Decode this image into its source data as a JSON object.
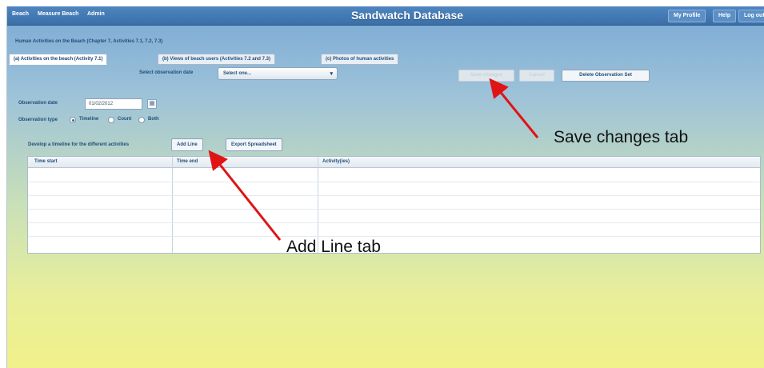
{
  "topbar": {
    "nav": [
      "Beach",
      "Measure Beach",
      "Admin"
    ],
    "title": "Sandwatch Database",
    "right_buttons": [
      "My Profile",
      "Help",
      "Log out"
    ]
  },
  "section_heading": "Human Activities on the Beach (Chapter 7, Activities 7.1, 7.2, 7.3)",
  "tabs": [
    {
      "label": "(a) Activities on the beach (Activity 7.1)",
      "active": true
    },
    {
      "label": "(b) Views of beach users (Activities 7.2 and 7.3)",
      "active": false
    },
    {
      "label": "(c) Photos of human activities",
      "active": false
    }
  ],
  "observation_select": {
    "label": "Select observation date",
    "value": "Select one..."
  },
  "actions": {
    "save_changes": "Save changes",
    "cancel": "Cancel",
    "delete_set": "Delete Observation Set"
  },
  "form": {
    "date_label": "Observation date",
    "date_value": "01/02/2012",
    "type_label": "Observation type",
    "types": [
      {
        "label": "Timeline",
        "checked": true
      },
      {
        "label": "Count",
        "checked": false
      },
      {
        "label": "Both",
        "checked": false
      }
    ]
  },
  "timeline": {
    "label": "Develop a timeline for the different activities",
    "add_line": "Add Line",
    "export": "Export Spreadsheet"
  },
  "table": {
    "columns": [
      "Time start",
      "Time end",
      "Activity(ies)"
    ],
    "row_count": 7
  },
  "annotations": {
    "save_changes": "Save changes tab",
    "add_line": "Add Line tab"
  },
  "colors": {
    "header_blue": "#3a6fa8",
    "arrow_red": "#e01414"
  }
}
